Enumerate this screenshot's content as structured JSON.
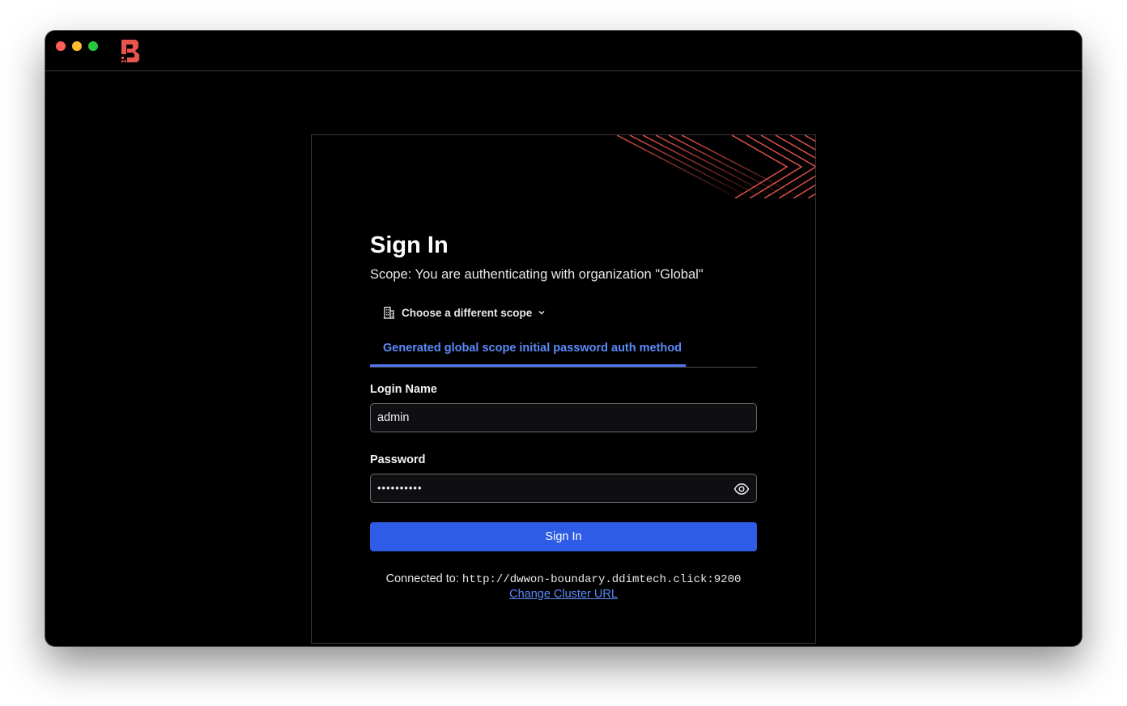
{
  "window": {
    "traffic_lights": [
      "close",
      "minimize",
      "maximize"
    ]
  },
  "colors": {
    "accent": "#2e5ce6",
    "link": "#5b8bfa",
    "brand": "#e8544e",
    "background": "#000000"
  },
  "signin": {
    "title": "Sign In",
    "subtitle": "Scope: You are authenticating with organization \"Global\"",
    "scope_button_label": "Choose a different scope",
    "auth_tab_label": "Generated global scope initial password auth method",
    "login_label": "Login Name",
    "login_value": "admin",
    "password_label": "Password",
    "password_mask": "••••••••••",
    "submit_label": "Sign In"
  },
  "footer": {
    "connected_label": "Connected to:",
    "cluster_url": "http://dwwon-boundary.ddimtech.click:9200",
    "change_link": "Change Cluster URL"
  },
  "icons": {
    "app": "boundary-logo-icon",
    "scope": "building-icon",
    "dropdown": "chevron-down-icon",
    "password_toggle": "eye-icon"
  }
}
